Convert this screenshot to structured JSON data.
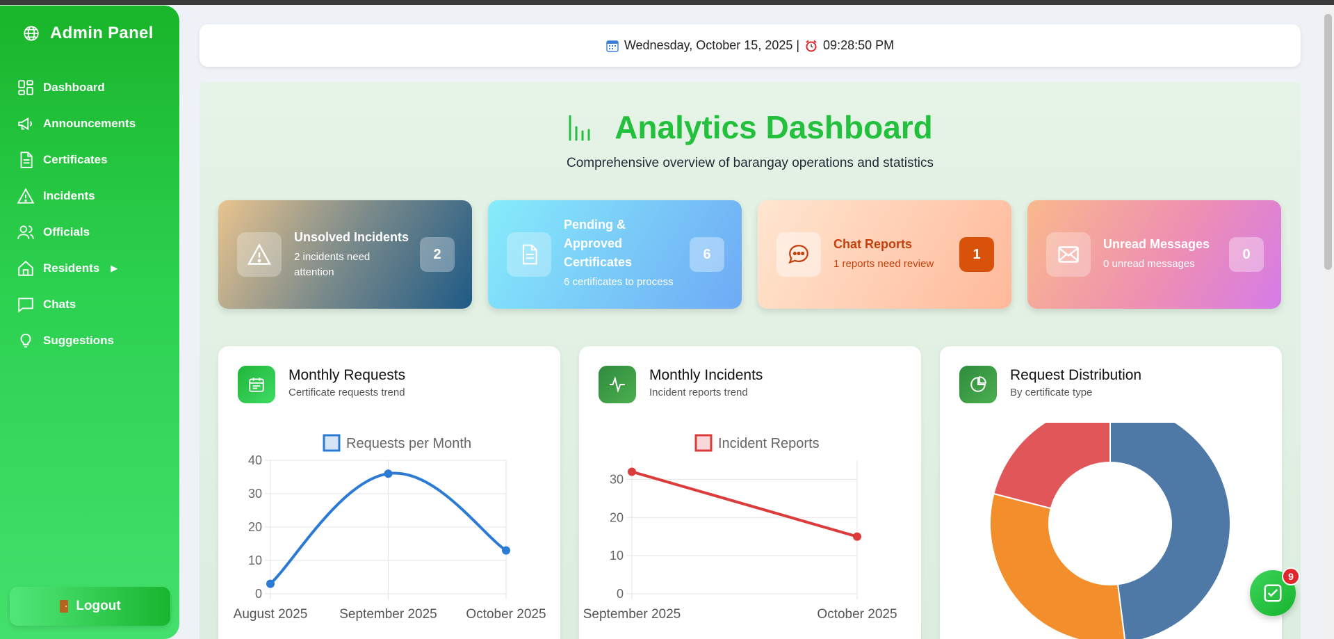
{
  "sidebar": {
    "brand": "Admin Panel",
    "brand_icon": "globe-icon",
    "items": [
      {
        "label": "Dashboard",
        "icon": "dashboard-icon"
      },
      {
        "label": "Announcements",
        "icon": "megaphone-icon"
      },
      {
        "label": "Certificates",
        "icon": "document-icon"
      },
      {
        "label": "Incidents",
        "icon": "warning-icon"
      },
      {
        "label": "Officials",
        "icon": "users-icon"
      },
      {
        "label": "Residents",
        "icon": "home-icon",
        "caret": "▶"
      },
      {
        "label": "Chats",
        "icon": "chat-icon"
      },
      {
        "label": "Suggestions",
        "icon": "lightbulb-icon"
      }
    ],
    "logout_label": "Logout"
  },
  "datebar": {
    "date": "Wednesday, October 15, 2025 |",
    "time": "09:28:50 PM"
  },
  "header": {
    "title": "Analytics Dashboard",
    "subtitle": "Comprehensive overview of barangay operations and statistics"
  },
  "stats": [
    {
      "title": "Unsolved Incidents",
      "desc": "2 incidents need attention",
      "count": "2",
      "icon": "warning-icon"
    },
    {
      "title": "Pending & Approved Certificates",
      "desc": "6 certificates to process",
      "count": "6",
      "icon": "document-icon"
    },
    {
      "title": "Chat Reports",
      "desc": "1 reports need review",
      "count": "1",
      "icon": "chat-dots-icon"
    },
    {
      "title": "Unread Messages",
      "desc": "0 unread messages",
      "count": "0",
      "icon": "envelope-icon"
    }
  ],
  "charts": [
    {
      "title": "Monthly Requests",
      "subtitle": "Certificate requests trend",
      "icon": "calendar-icon"
    },
    {
      "title": "Monthly Incidents",
      "subtitle": "Incident reports trend",
      "icon": "activity-icon"
    },
    {
      "title": "Request Distribution",
      "subtitle": "By certificate type",
      "icon": "pie-icon"
    }
  ],
  "chart_data": [
    {
      "type": "line",
      "legend": "Requests per Month",
      "color": "#2b7bd4",
      "categories": [
        "August 2025",
        "September 2025",
        "October 2025"
      ],
      "values": [
        3,
        36,
        13
      ],
      "ylim": [
        0,
        40
      ],
      "yticks": [
        0,
        10,
        20,
        30,
        40
      ],
      "grid": true
    },
    {
      "type": "line",
      "legend": "Incident Reports",
      "color": "#dc3b3b",
      "categories": [
        "September 2025",
        "October 2025"
      ],
      "values": [
        32,
        15
      ],
      "ylim": [
        0,
        35
      ],
      "yticks": [
        0,
        10,
        20,
        30
      ],
      "grid": true
    },
    {
      "type": "pie",
      "colors": [
        "#4e79a7",
        "#f28e2b",
        "#e15759"
      ],
      "values": [
        48,
        31,
        21
      ]
    }
  ],
  "fab": {
    "icon": "checklist-icon",
    "badge": "9"
  }
}
